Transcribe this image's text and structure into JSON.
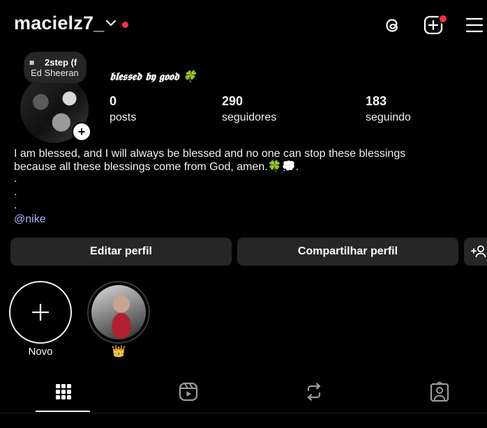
{
  "header": {
    "username": "macielz7_",
    "icons": [
      "chevron-down-icon",
      "threads-icon",
      "new-post-icon",
      "menu-icon"
    ],
    "accent_notification": "#ff3040"
  },
  "note": {
    "bars": "ııı",
    "song": "2step (f",
    "artist": "Ed Sheeran"
  },
  "profile": {
    "full_name": "𝖇𝖑𝖊𝖘𝖘𝖊𝖉 𝖇𝖞 𝖌𝖔𝖔𝖉 🍀",
    "stats": [
      {
        "value": "0",
        "label": "posts"
      },
      {
        "value": "290",
        "label": "seguidores"
      },
      {
        "value": "183",
        "label": "seguindo"
      }
    ],
    "bio_line1": "I am blessed, and I will always be blessed and no one can stop these blessings",
    "bio_line2": "because all these blessings come from God, amen.🍀💭.",
    "bio_dots": [
      ".",
      ".",
      "."
    ],
    "link_text": "@nike",
    "link_color": "#a5b4fc"
  },
  "actions": {
    "edit_label": "Editar perfil",
    "share_label": "Compartilhar perfil",
    "add_icon": "add-person-icon"
  },
  "highlights": [
    {
      "label": "Novo",
      "icon": "plus-icon"
    },
    {
      "label": "👑",
      "icon": "highlight-cover"
    }
  ],
  "tabs": [
    {
      "name": "grid",
      "icon": "grid-icon",
      "active": true
    },
    {
      "name": "reels",
      "icon": "reels-icon",
      "active": false
    },
    {
      "name": "reposts",
      "icon": "repost-icon",
      "active": false
    },
    {
      "name": "tagged",
      "icon": "tagged-icon",
      "active": false
    }
  ]
}
